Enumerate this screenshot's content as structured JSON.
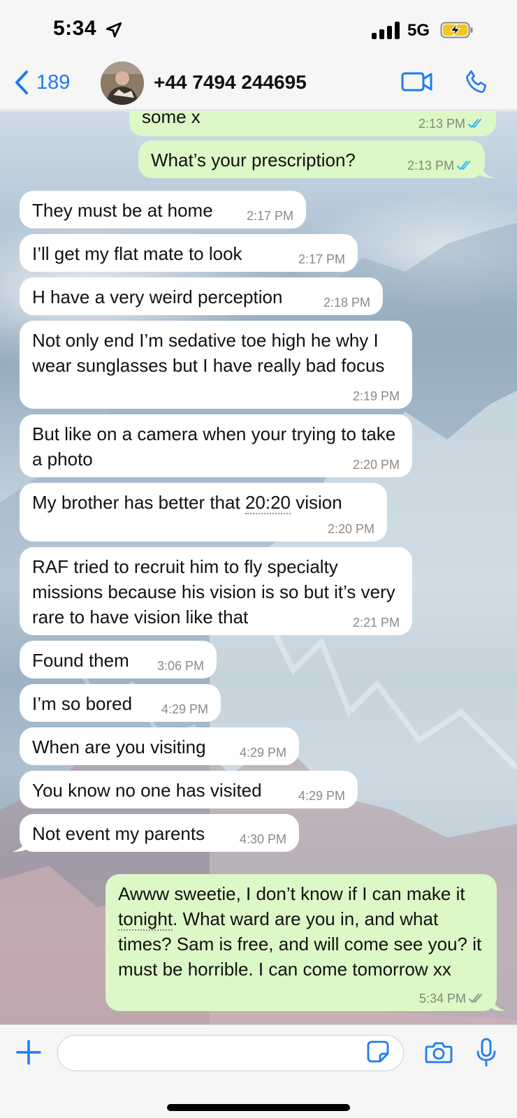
{
  "status_bar": {
    "time": "5:34",
    "network": "5G"
  },
  "header": {
    "back_count": "189",
    "contact": "+44 7494 244695"
  },
  "messages": [
    {
      "dir": "out",
      "text": "some x",
      "time": "2:13 PM",
      "status": "read"
    },
    {
      "dir": "out",
      "text": "What’s your prescription?",
      "time": "2:13 PM",
      "status": "read"
    },
    {
      "dir": "in",
      "text": "They must be at home",
      "time": "2:17 PM"
    },
    {
      "dir": "in",
      "text": "I’ll get my flat mate to look",
      "time": "2:17 PM"
    },
    {
      "dir": "in",
      "text": "H have a very weird perception",
      "time": "2:18 PM"
    },
    {
      "dir": "in",
      "text": "Not only end I’m sedative toe high he why I wear sunglasses but I have really bad focus",
      "time": "2:19 PM"
    },
    {
      "dir": "in",
      "text": "But like on a camera when your trying to take a photo",
      "time": "2:20 PM"
    },
    {
      "dir": "in",
      "text_before": "My brother has better that ",
      "text_link": "20:20",
      "text_after": " vision",
      "time": "2:20 PM"
    },
    {
      "dir": "in",
      "text": "RAF tried to recruit him to fly specialty missions because his vision is so but it’s very rare to have vision like that",
      "time": "2:21 PM"
    },
    {
      "dir": "in",
      "text": "Found them",
      "time": "3:06 PM"
    },
    {
      "dir": "in",
      "text": "I’m so bored",
      "time": "4:29 PM"
    },
    {
      "dir": "in",
      "text": "When are you visiting",
      "time": "4:29 PM"
    },
    {
      "dir": "in",
      "text": "You know no one has visited",
      "time": "4:29 PM"
    },
    {
      "dir": "in",
      "text": "Not event my parents",
      "time": "4:30 PM"
    },
    {
      "dir": "out",
      "text_before": "Awww sweetie, I don’t know if I can make it ",
      "text_link": "tonight",
      "text_after": ". What ward are you in,  and what times? Sam is free, and will come see you? it must be horrible. I can come tomorrow xx",
      "time": "5:34 PM",
      "status": "delivered"
    }
  ],
  "colors": {
    "accent": "#1c7cf2",
    "outgoing_bubble": "#dcf8c6",
    "incoming_bubble": "#ffffff",
    "read_ticks": "#34b7f1",
    "battery_charging": "#f5c61a"
  },
  "icons": [
    "location-arrow-icon",
    "signal-icon",
    "battery-charging-icon",
    "chevron-left-icon",
    "video-camera-icon",
    "phone-icon",
    "double-check-icon",
    "plus-icon",
    "sticker-icon",
    "camera-icon",
    "microphone-icon"
  ]
}
